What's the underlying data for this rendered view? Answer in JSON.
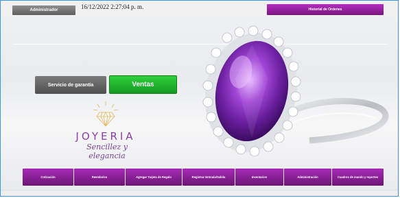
{
  "header": {
    "user_label": "Administrador",
    "datetime": "16/12/2022 2:27:04 p. m.",
    "history_button": "Historial de Ordenes"
  },
  "main": {
    "warranty_button": "Servicio de garantía",
    "sales_button": "Ventas"
  },
  "logo": {
    "title": "JOYERIA",
    "tagline": "Sencillez y elegancia"
  },
  "bottom_nav": [
    {
      "label": "Cotización"
    },
    {
      "label": "Reembolso"
    },
    {
      "label": "Agregar Tarjeta de Regalo"
    },
    {
      "label": "Registrar Entrada/Salida"
    },
    {
      "label": "Inventarios"
    },
    {
      "label": "Administración"
    },
    {
      "label": "Cuadros de mando y reportes"
    }
  ],
  "colors": {
    "accent_purple": "#9b26a8",
    "sales_green": "#22b52f",
    "logo_purple": "#8b3fa6",
    "gold": "#e2b85a"
  }
}
